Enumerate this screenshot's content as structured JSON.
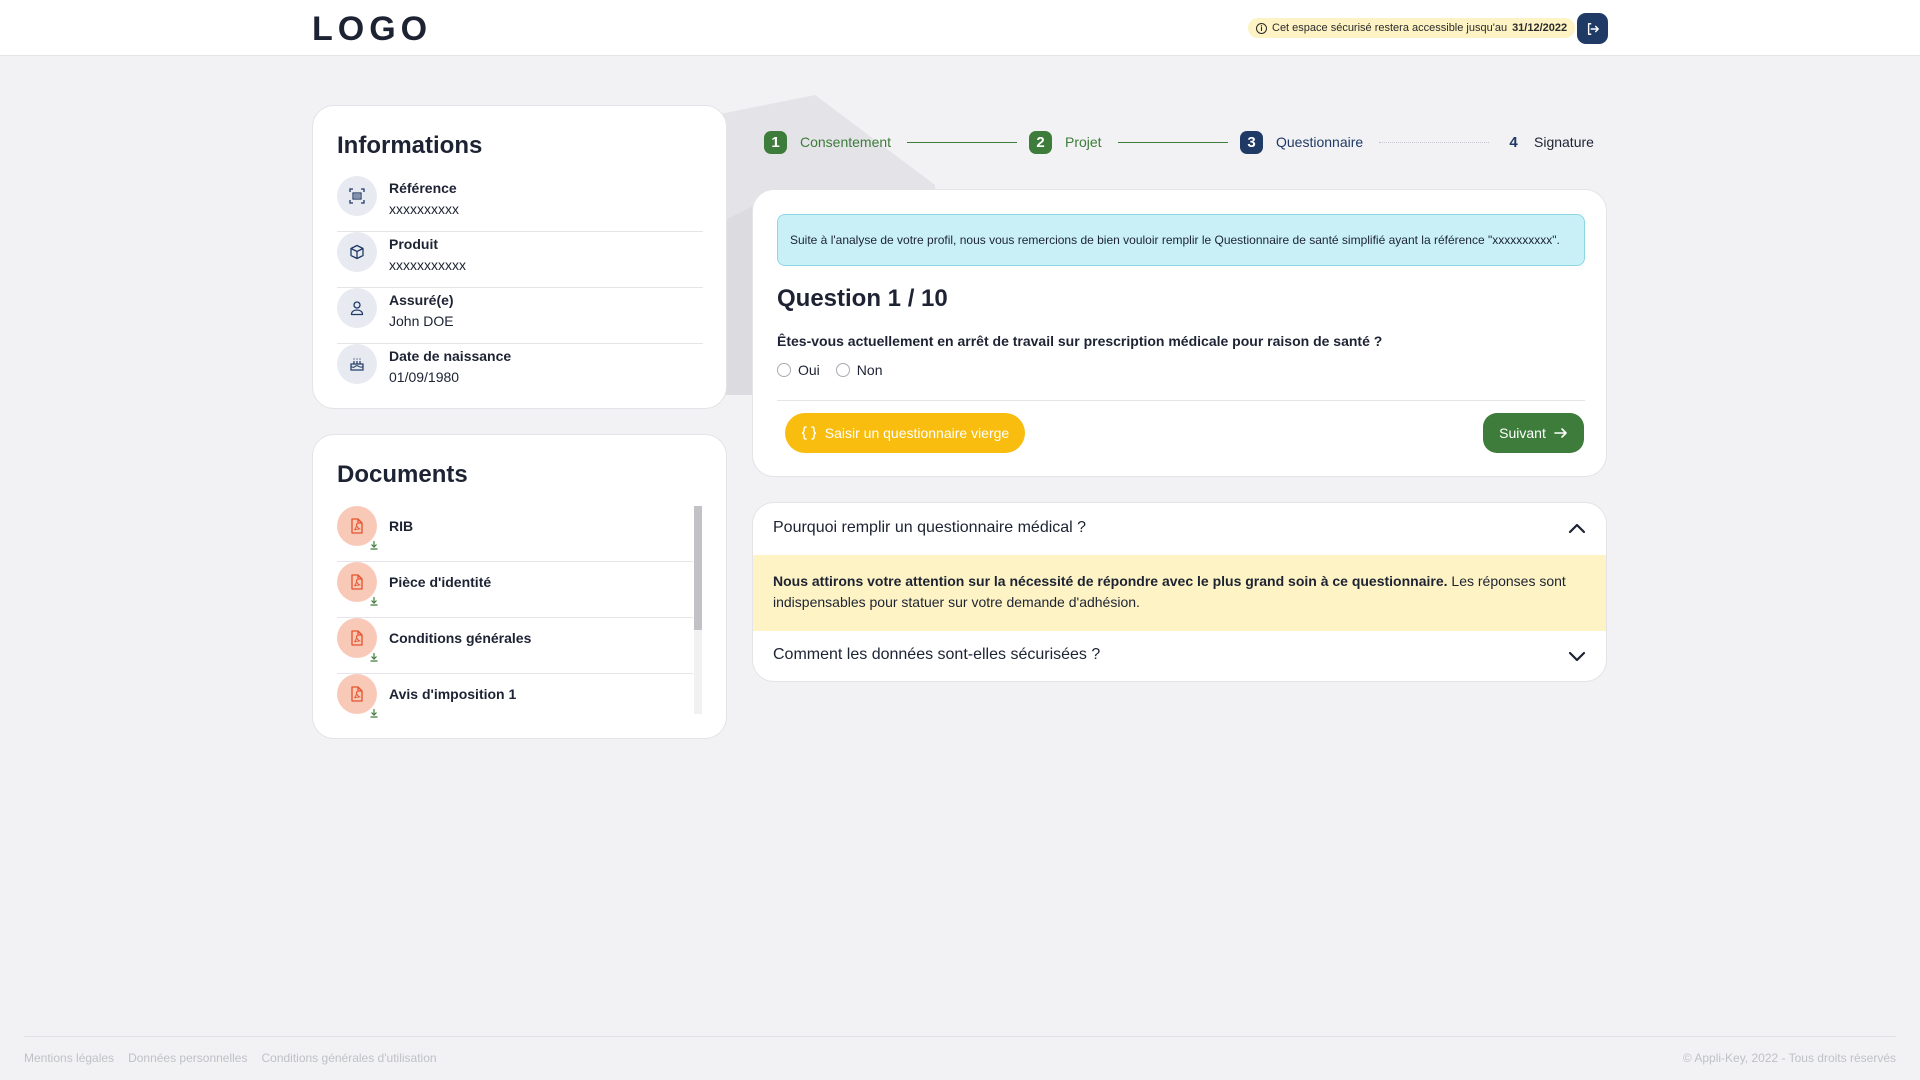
{
  "header": {
    "logo": "LOGO",
    "notice_text": "Cet espace sécurisé restera accessible jusqu'au",
    "notice_date": "31/12/2022",
    "logout_icon": "logout-icon"
  },
  "informations": {
    "title": "Informations",
    "items": [
      {
        "label": "Référence",
        "value": "xxxxxxxxxx",
        "icon": "barcode-scan-icon"
      },
      {
        "label": "Produit",
        "value": "xxxxxxxxxxx",
        "icon": "cube-icon"
      },
      {
        "label": "Assuré(e)",
        "value": "John DOE",
        "icon": "user-icon"
      },
      {
        "label": "Date de naissance",
        "value": "01/09/1980",
        "icon": "birthday-cake-icon"
      }
    ]
  },
  "documents": {
    "title": "Documents",
    "items": [
      {
        "name": "RIB",
        "icon": "pdf-file-icon"
      },
      {
        "name": "Pièce d'identité",
        "icon": "pdf-file-icon"
      },
      {
        "name": "Conditions générales",
        "icon": "pdf-file-icon"
      },
      {
        "name": "Avis d'imposition 1",
        "icon": "pdf-file-icon"
      }
    ]
  },
  "stepper": {
    "steps": [
      {
        "num": "1",
        "label": "Consentement",
        "state": "done"
      },
      {
        "num": "2",
        "label": "Projet",
        "state": "done"
      },
      {
        "num": "3",
        "label": "Questionnaire",
        "state": "active"
      },
      {
        "num": "4",
        "label": "Signature",
        "state": "todo"
      }
    ]
  },
  "question": {
    "alert": "Suite à l'analyse de votre profil, nous vous remercions de bien vouloir remplir le Questionnaire de santé simplifié ayant la référence \"xxxxxxxxxx\".",
    "title": "Question 1 / 10",
    "text": "Êtes-vous actuellement en arrêt de travail sur prescription médicale pour raison de santé ?",
    "options": [
      "Oui",
      "Non"
    ],
    "blank_button": "Saisir un questionnaire vierge",
    "next_button": "Suivant"
  },
  "faq": {
    "q1": "Pourquoi remplir un questionnaire médical ?",
    "a1_bold": "Nous attirons votre attention sur la nécessité de répondre avec le plus grand soin à ce questionnaire.",
    "a1_rest": " Les réponses sont indispensables pour statuer sur votre demande d'adhésion.",
    "q2": "Comment les données sont-elles sécurisées ?"
  },
  "footer": {
    "links": [
      "Mentions légales",
      "Données personnelles",
      "Conditions générales d'utilisation"
    ],
    "copyright": "© Appli-Key, 2022 - Tous droits réservés"
  },
  "colors": {
    "primary": "#1f3a64",
    "success": "#3d7c3a",
    "warning": "#f8bd0f",
    "info_bg": "#c9f0f7",
    "highlight_bg": "#fdf3c4"
  }
}
